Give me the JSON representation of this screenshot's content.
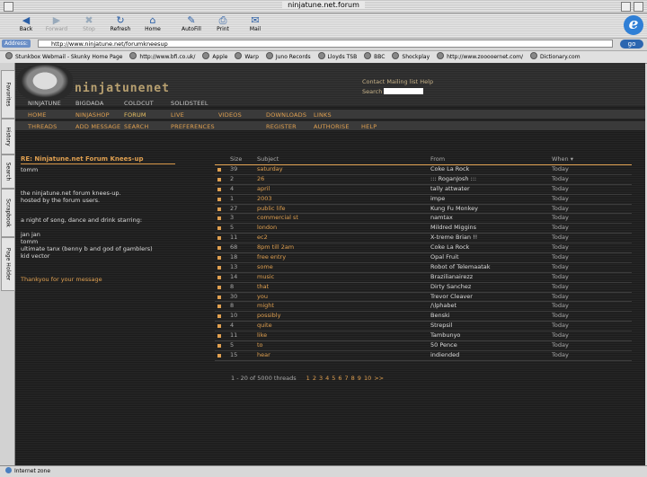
{
  "window": {
    "title": "ninjatune.net.forum"
  },
  "toolbar": {
    "buttons": [
      {
        "label": "Back",
        "icon": "back-arrow-icon",
        "enabled": true
      },
      {
        "label": "Forward",
        "icon": "forward-arrow-icon",
        "enabled": false
      },
      {
        "label": "Stop",
        "icon": "stop-icon",
        "enabled": false
      },
      {
        "label": "Refresh",
        "icon": "refresh-icon",
        "enabled": true
      },
      {
        "label": "Home",
        "icon": "home-icon",
        "enabled": true
      },
      {
        "label": "AutoFill",
        "icon": "autofill-icon",
        "enabled": true
      },
      {
        "label": "Print",
        "icon": "print-icon",
        "enabled": true
      },
      {
        "label": "Mail",
        "icon": "mail-icon",
        "enabled": true
      }
    ]
  },
  "address": {
    "label": "Address:",
    "url": "http://www.ninjatune.net/forumkneesup",
    "go": "go"
  },
  "favorites": [
    "Stunkbox Webmail - Skunky Home Page",
    "http://www.bfi.co.uk/",
    "Apple",
    "Warp",
    "Juno Records",
    "Lloyds TSB",
    "BBC",
    "Shockplay",
    "http://www.zooooernet.com/",
    "Dictionary.com"
  ],
  "side_tabs": [
    "Favorites",
    "History",
    "Search",
    "Scrapbook",
    "Page Holder"
  ],
  "status": {
    "text": "Internet zone"
  },
  "site": {
    "logo_text": "ninjatunenet",
    "header_links": "Contact  Mailing list  Help",
    "search_label": "Search",
    "sites": [
      "NINJATUNE",
      "BIGDADA",
      "COLDCUT",
      "SOLIDSTEEL"
    ],
    "nav1": [
      "HOME",
      "NINJASHOP",
      "FORUM",
      "LIVE",
      "VIDEOS",
      "DOWNLOADS",
      "LINKS"
    ],
    "nav2": [
      "THREADS",
      "ADD MESSAGE",
      "SEARCH",
      "PREFERENCES",
      "REGISTER",
      "AUTHORISE",
      "HELP"
    ]
  },
  "message": {
    "title": "RE: Ninjatune.net Forum Knees-up",
    "author": "tomm",
    "lines1": [
      "the ninjatune.net forum knees-up.",
      "hosted by the forum users."
    ],
    "line2": "a night of song, dance and drink starring:",
    "lines3": [
      "jan jan",
      "tomm",
      "ultimate tanx (benny b and god of gamblers)",
      "kid vector"
    ],
    "thanks": "Thankyou for your message"
  },
  "threads": {
    "headers": {
      "size": "Size",
      "subject": "Subject",
      "from": "From",
      "when": "When ▾"
    },
    "rows": [
      {
        "size": "39",
        "subject": "saturday",
        "from": "Coke La Rock",
        "when": "Today"
      },
      {
        "size": "2",
        "subject": "26",
        "from": "::: RoganJosh :::",
        "when": "Today"
      },
      {
        "size": "4",
        "subject": "april",
        "from": "tally attwater",
        "when": "Today"
      },
      {
        "size": "1",
        "subject": "2003",
        "from": "impe",
        "when": "Today"
      },
      {
        "size": "27",
        "subject": "public life",
        "from": "Kung Fu Monkey",
        "when": "Today"
      },
      {
        "size": "3",
        "subject": "commercial st",
        "from": "namtax",
        "when": "Today"
      },
      {
        "size": "5",
        "subject": "london",
        "from": "Mildred Miggins",
        "when": "Today"
      },
      {
        "size": "11",
        "subject": "ec2",
        "from": "X-treme Brian !!",
        "when": "Today"
      },
      {
        "size": "68",
        "subject": "8pm till 2am",
        "from": "Coke La Rock",
        "when": "Today"
      },
      {
        "size": "18",
        "subject": "free entry",
        "from": "Opal Fruit",
        "when": "Today"
      },
      {
        "size": "13",
        "subject": "some",
        "from": "Robot of Telemaatak",
        "when": "Today"
      },
      {
        "size": "14",
        "subject": "music",
        "from": "Brazilianairezz",
        "when": "Today"
      },
      {
        "size": "8",
        "subject": "that",
        "from": "Dirty Sanchez",
        "when": "Today"
      },
      {
        "size": "30",
        "subject": "you",
        "from": "Trevor Cleaver",
        "when": "Today"
      },
      {
        "size": "8",
        "subject": "might",
        "from": "/\\lphabet",
        "when": "Today"
      },
      {
        "size": "10",
        "subject": "possibly",
        "from": "Benski",
        "when": "Today"
      },
      {
        "size": "4",
        "subject": "quite",
        "from": "Strepsil",
        "when": "Today"
      },
      {
        "size": "11",
        "subject": "like",
        "from": "Tambunyo",
        "when": "Today"
      },
      {
        "size": "5",
        "subject": "to",
        "from": "50 Pence",
        "when": "Today"
      },
      {
        "size": "15",
        "subject": "hear",
        "from": "indiended",
        "when": "Today"
      }
    ],
    "pager_text": "1 - 20 of 5000 threads",
    "pages": [
      "1",
      "2",
      "3",
      "4",
      "5",
      "6",
      "7",
      "8",
      "9",
      "10",
      ">>"
    ]
  }
}
